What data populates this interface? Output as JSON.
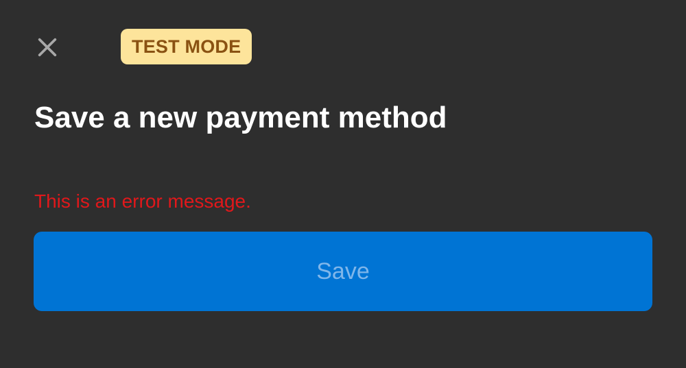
{
  "header": {
    "close_icon": "close-icon",
    "badge_label": "TEST MODE"
  },
  "main": {
    "title": "Save a new payment method",
    "error_message": "This is an error message.",
    "save_label": "Save"
  },
  "colors": {
    "background": "#2e2e2e",
    "badge_background": "#fde49b",
    "badge_text": "#8a5212",
    "error_text": "#e0181b",
    "primary_button": "#0074d4",
    "primary_button_text_disabled": "#7fb6ea"
  }
}
